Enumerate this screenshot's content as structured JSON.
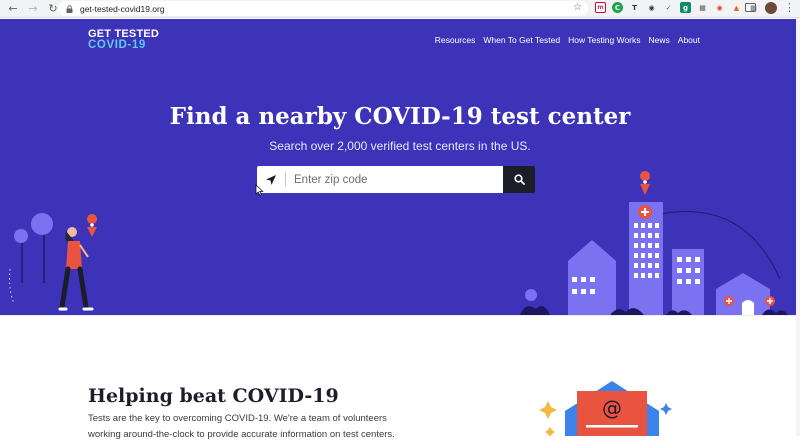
{
  "browser": {
    "url": "get-tested-covid19.org",
    "back_icon": "arrow-left-icon",
    "forward_icon": "arrow-right-icon",
    "reload_icon": "reload-icon",
    "star_icon": "star-icon"
  },
  "site": {
    "logo_line1": "GET TESTED",
    "logo_line2": "COVID-19",
    "nav": [
      "Resources",
      "When To Get Tested",
      "How Testing Works",
      "News",
      "About"
    ]
  },
  "hero": {
    "title": "Find a nearby COVID-19 test center",
    "subtitle": "Search over 2,000 verified test centers in the US.",
    "zip_placeholder": "Enter zip code",
    "background_color": "#3d33b8",
    "accent_color": "#5ec8f2"
  },
  "section": {
    "title": "Helping beat COVID-19",
    "body": "Tests are the key to overcoming COVID-19. We're a team of volunteers working around-the-clock to provide accurate information on test centers."
  }
}
